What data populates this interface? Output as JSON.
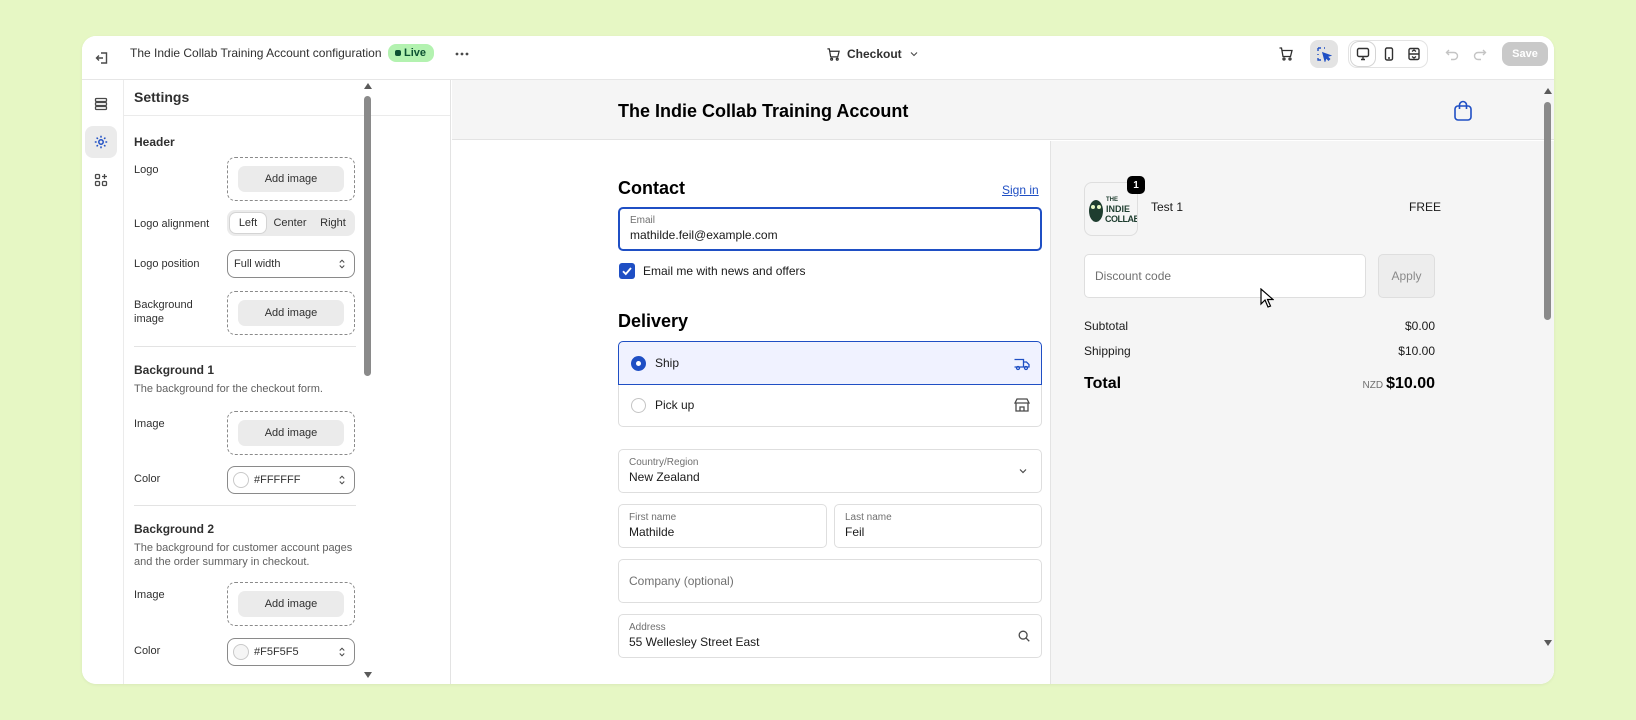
{
  "topbar": {
    "exit_icon": "exit-icon",
    "title": "The Indie Collab Training Account configuration",
    "live_badge": "Live",
    "page_selector": "Checkout",
    "save": "Save"
  },
  "panel": {
    "title": "Settings",
    "header_section": "Header",
    "logo_label": "Logo",
    "add_image": "Add image",
    "logo_alignment_label": "Logo alignment",
    "alignment_options": [
      "Left",
      "Center",
      "Right"
    ],
    "logo_position_label": "Logo position",
    "logo_position_value": "Full width",
    "background_image_label": "Background image",
    "bg1_title": "Background 1",
    "bg1_desc": "The background for the checkout form.",
    "image_label": "Image",
    "color_label": "Color",
    "bg1_color": "#FFFFFF",
    "bg2_title": "Background 2",
    "bg2_desc": "The background for customer account pages and the order summary in checkout.",
    "bg2_color": "#F5F5F5"
  },
  "checkout": {
    "store_name": "The Indie Collab Training Account",
    "contact_title": "Contact",
    "sign_in": "Sign in",
    "email_label": "Email",
    "email_value": "mathilde.feil@example.com",
    "newsletter": "Email me with news and offers",
    "delivery_title": "Delivery",
    "ship": "Ship",
    "pickup": "Pick up",
    "country_label": "Country/Region",
    "country_value": "New Zealand",
    "first_name_label": "First name",
    "first_name_value": "Mathilde",
    "last_name_label": "Last name",
    "last_name_value": "Feil",
    "company_placeholder": "Company (optional)",
    "address_label": "Address",
    "address_value": "55 Wellesley Street East"
  },
  "summary": {
    "logo_text_small": "THE",
    "logo_text_1": "INDIE",
    "logo_text_2": "COLLAB",
    "qty_badge": "1",
    "product_name": "Test 1",
    "product_price": "FREE",
    "discount_placeholder": "Discount code",
    "apply": "Apply",
    "subtotal_label": "Subtotal",
    "subtotal_value": "$0.00",
    "shipping_label": "Shipping",
    "shipping_value": "$10.00",
    "total_label": "Total",
    "currency": "NZD",
    "total_value": "$10.00"
  },
  "colors": {
    "accent": "#1f4fc4",
    "live_bg": "#b3f2b0",
    "page_bg": "#e6f7c4"
  }
}
